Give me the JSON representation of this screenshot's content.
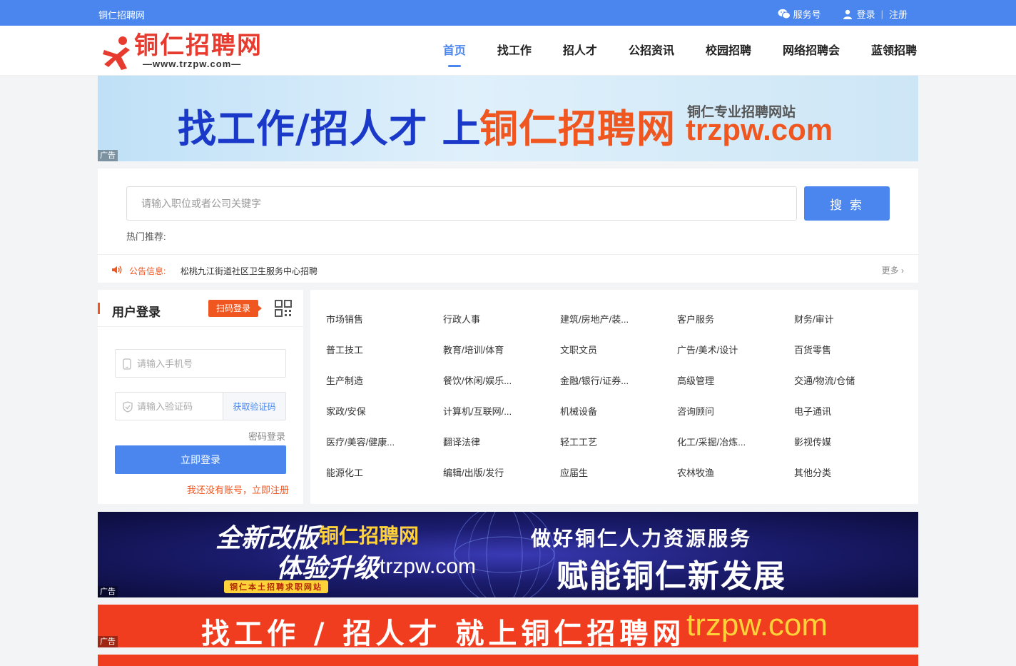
{
  "topbar": {
    "site_name": "铜仁招聘网",
    "service": "服务号",
    "login": "登录",
    "register": "注册"
  },
  "logo": {
    "name": "铜仁招聘网",
    "url": "—www.trzpw.com—"
  },
  "nav": {
    "items": [
      "首页",
      "找工作",
      "招人才",
      "公招资讯",
      "校园招聘",
      "网络招聘会",
      "蓝领招聘"
    ],
    "active": "首页"
  },
  "banner1": {
    "slogan_a": "找工作/招人才 上",
    "slogan_b": "铜仁招聘网",
    "subtitle": "铜仁专业招聘网站",
    "domain": "trzpw.com",
    "ad_label": "广告"
  },
  "search": {
    "placeholder": "请输入职位或者公司关键字",
    "button": "搜 索",
    "hot_label": "热门推荐:"
  },
  "notice": {
    "label": "公告信息:",
    "text": "松桃九江街道社区卫生服务中心招聘",
    "more": "更多 ›"
  },
  "login": {
    "title": "用户登录",
    "qr_login": "扫码登录",
    "phone_placeholder": "请输入手机号",
    "code_placeholder": "请输入验证码",
    "get_code": "获取验证码",
    "password_login": "密码登录",
    "submit": "立即登录",
    "register_link": "我还没有账号，立即注册"
  },
  "categories": [
    "市场销售",
    "行政人事",
    "建筑/房地产/装...",
    "客户服务",
    "财务/审计",
    "普工技工",
    "教育/培训/体育",
    "文职文员",
    "广告/美术/设计",
    "百货零售",
    "生产制造",
    "餐饮/休闲/娱乐...",
    "金融/银行/证券...",
    "高级管理",
    "交通/物流/仓储",
    "家政/安保",
    "计算机/互联网/...",
    "机械设备",
    "咨询顾问",
    "电子通讯",
    "医疗/美容/健康...",
    "翻译法律",
    "轻工工艺",
    "化工/采掘/冶炼...",
    "影视传媒",
    "能源化工",
    "编辑/出版/发行",
    "应届生",
    "农林牧渔",
    "其他分类"
  ],
  "banner2": {
    "line1a": "全新改版",
    "line1b": "铜仁招聘网",
    "line2a": "体验升级",
    "line2b": "trzpw.com",
    "tag": "铜仁本土招聘求职网站",
    "right1": "做好铜仁人力资源服务",
    "right2": "赋能铜仁新发展",
    "ad_label": "广告"
  },
  "banner3": {
    "slogan": "找工作 / 招人才  就上铜仁招聘网",
    "domain": "trzpw.com",
    "ad_label": "广告"
  },
  "colors": {
    "primary": "#4a86ee",
    "accent": "#f0561f"
  }
}
